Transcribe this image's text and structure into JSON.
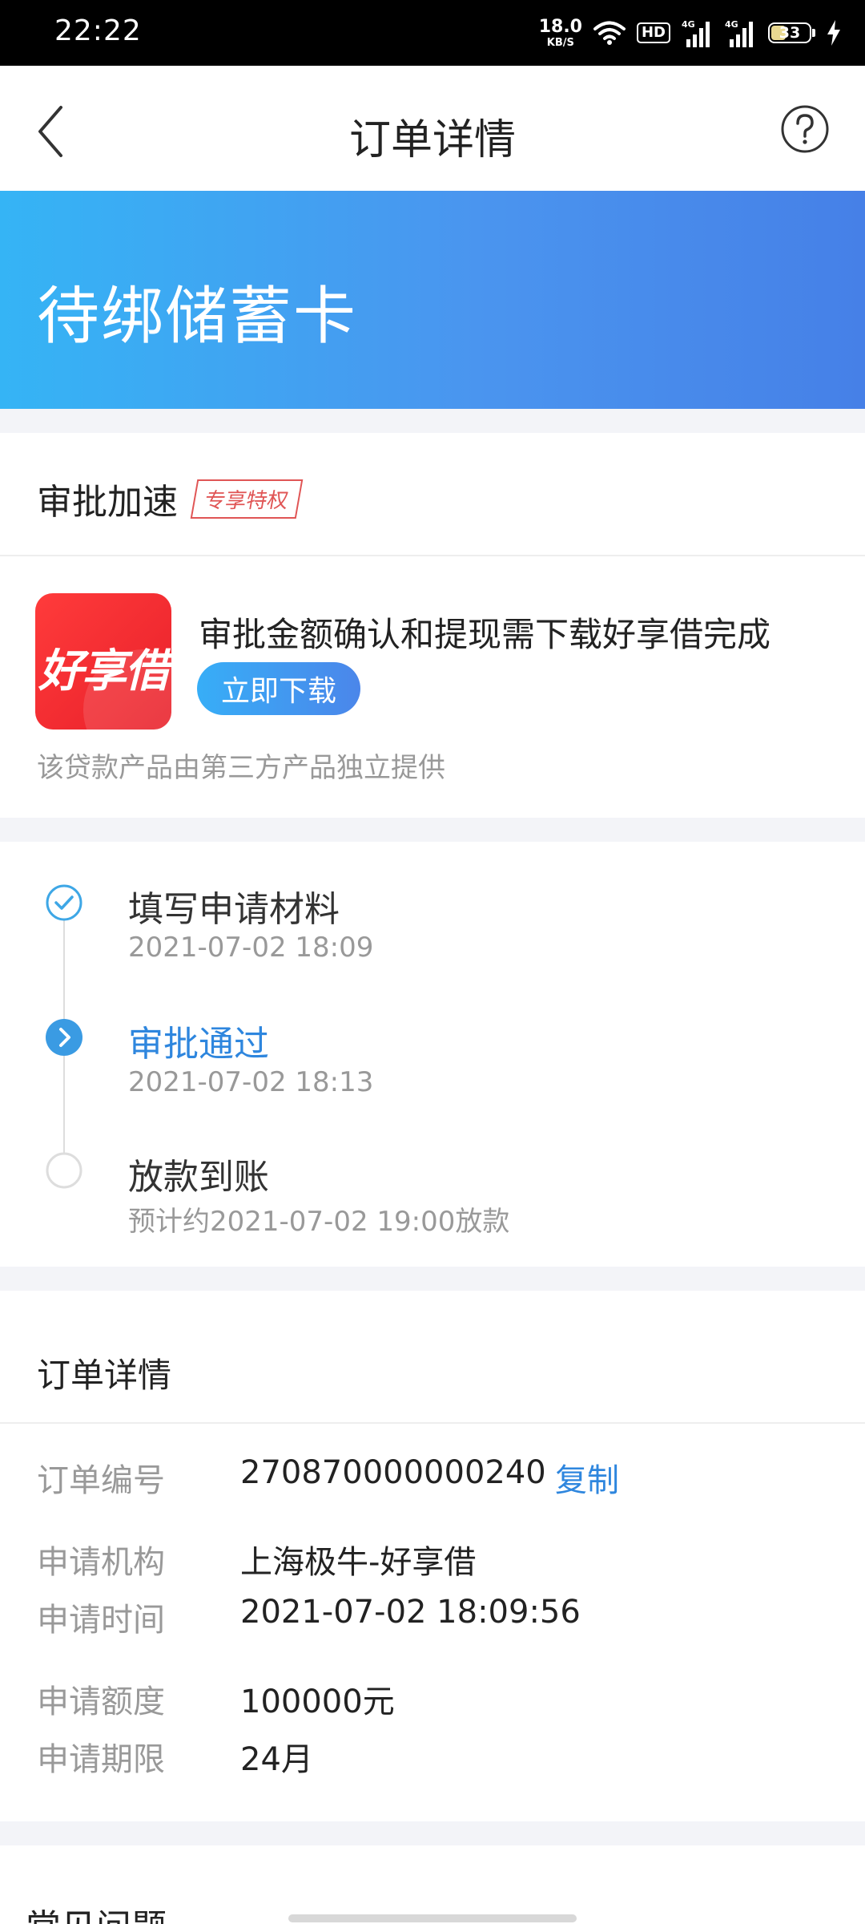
{
  "status_bar": {
    "time": "22:22",
    "net_speed": "18.0",
    "net_unit": "KB/S",
    "hd_label": "HD",
    "signal1_label": "4G",
    "signal2_label": "4G",
    "battery": "33"
  },
  "header": {
    "title": "订单详情"
  },
  "banner": {
    "status": "待绑储蓄卡"
  },
  "accelerate": {
    "title": "审批加速",
    "tag": "专享特权",
    "app_name": "好享借",
    "description": "审批金额确认和提现需下载好享借完成",
    "download_button": "立即下载",
    "note": "该贷款产品由第三方产品独立提供"
  },
  "progress": {
    "steps": [
      {
        "title": "填写申请材料",
        "time": "2021-07-02 18:09",
        "state": "done"
      },
      {
        "title": "审批通过",
        "time": "2021-07-02 18:13",
        "state": "current"
      },
      {
        "title": "放款到账",
        "time": "预计约2021-07-02 19:00放款",
        "state": "pending"
      }
    ]
  },
  "order": {
    "section_title": "订单详情",
    "copy_label": "复制",
    "rows": [
      {
        "label": "订单编号",
        "value": "270870000000240"
      },
      {
        "label": "申请机构",
        "value": "上海极牛-好享借"
      },
      {
        "label": "申请时间",
        "value": "2021-07-02 18:09:56"
      },
      {
        "label": "申请额度",
        "value": "100000元"
      },
      {
        "label": "申请期限",
        "value": "24月"
      }
    ]
  },
  "faq": {
    "title": "常见问题"
  },
  "colors": {
    "accent": "#2e86de",
    "banner_start": "#35b4f5",
    "banner_end": "#4680e7",
    "tag_red": "#e05555"
  }
}
